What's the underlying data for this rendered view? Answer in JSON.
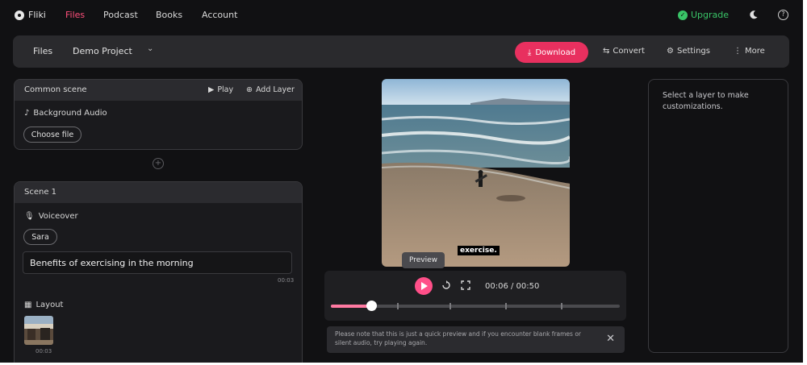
{
  "app": {
    "name": "Fliki"
  },
  "nav": {
    "items": [
      {
        "label": "Files",
        "active": true
      },
      {
        "label": "Podcast",
        "active": false
      },
      {
        "label": "Books",
        "active": false
      },
      {
        "label": "Account",
        "active": false
      }
    ],
    "upgrade_label": "Upgrade"
  },
  "toolbar": {
    "breadcrumb_root": "Files",
    "project_name": "Demo Project",
    "download_label": "Download",
    "convert_label": "Convert",
    "settings_label": "Settings",
    "more_label": "More"
  },
  "common_scene": {
    "title": "Common scene",
    "play_label": "Play",
    "add_layer_label": "Add Layer",
    "background_audio_label": "Background Audio",
    "choose_file_label": "Choose file"
  },
  "scene1": {
    "title": "Scene 1",
    "voiceover_label": "Voiceover",
    "voice_name": "Sara",
    "text": "Benefits of exercising in the morning",
    "duration": "00:03",
    "layout_label": "Layout",
    "layout_duration": "00:03"
  },
  "preview": {
    "caption": "exercise.",
    "tooltip": "Preview",
    "time_display": "00:06 / 00:50",
    "progress_fraction": 0.14,
    "notice": "Please note that this is just a quick preview and if you encounter blank frames or silent audio, try playing again."
  },
  "right_panel": {
    "hint": "Select a layer to make customizations."
  },
  "colors": {
    "accent": "#e8305f",
    "upgrade": "#39c467",
    "active_nav": "#ff4f7b",
    "background": "#111113"
  }
}
